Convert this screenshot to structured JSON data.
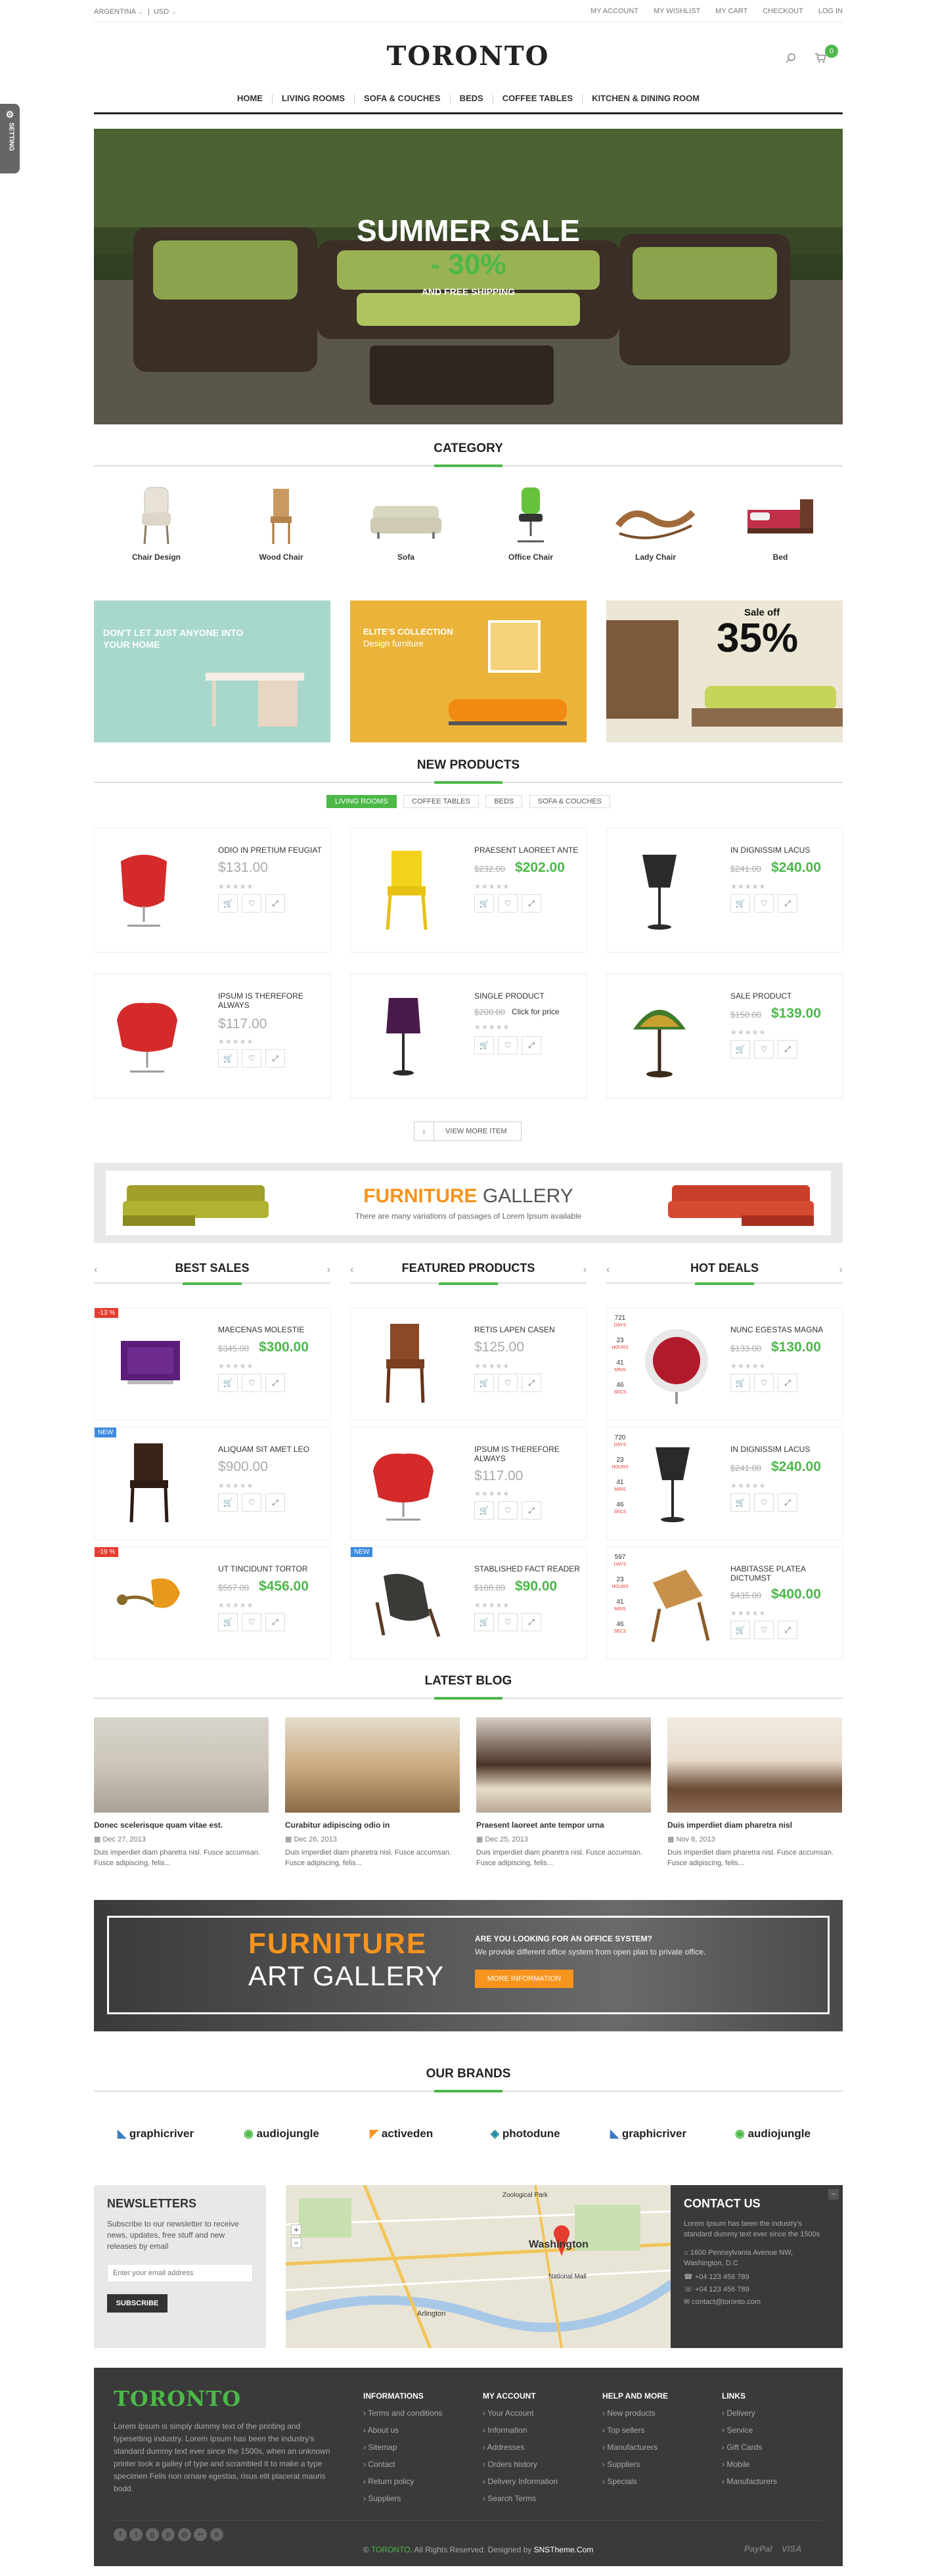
{
  "topbar": {
    "country": "ARGENTINA",
    "currency": "USD",
    "links": [
      "MY ACCOUNT",
      "MY WISHLIST",
      "MY CART",
      "CHECKOUT",
      "LOG IN"
    ]
  },
  "logo": "TORONTO",
  "cart_count": "0",
  "setting_label": "SETTING",
  "nav": [
    "HOME",
    "LIVING ROOMS",
    "SOFA & COUCHES",
    "BEDS",
    "COFFEE TABLES",
    "KITCHEN & DINING ROOM"
  ],
  "hero": {
    "title": "SUMMER SALE",
    "discount": "- 30%",
    "sub": "AND FREE SHIPPING"
  },
  "category": {
    "title": "CATEGORY",
    "items": [
      "Chair Design",
      "Wood Chair",
      "Sofa",
      "Office Chair",
      "Lady Chair",
      "Bed"
    ]
  },
  "banners": {
    "b1": "DON'T LET JUST ANYONE INTO YOUR HOME",
    "b2a": "ELITE'S COLLECTION",
    "b2b": "Design furniture",
    "b3a": "Sale off",
    "b3b": "35%"
  },
  "new_products": {
    "title": "NEW PRODUCTS",
    "tabs": [
      "LIVING ROOMS",
      "COFFEE TABLES",
      "BEDS",
      "SOFA & COUCHES"
    ],
    "items": [
      {
        "name": "ODIO IN PRETIUM FEUGIAT",
        "old": "",
        "price": "$131.00"
      },
      {
        "name": "PRAESENT LAOREET ANTE",
        "old": "$232.00",
        "price": "$202.00"
      },
      {
        "name": "IN DIGNISSIM LACUS",
        "old": "$241.00",
        "price": "$240.00"
      },
      {
        "name": "IPSUM IS THEREFORE ALWAYS",
        "old": "",
        "price": "$117.00"
      },
      {
        "name": "SINGLE PRODUCT",
        "old": "$200.00",
        "price": "Click for price"
      },
      {
        "name": "SALE PRODUCT",
        "old": "$150.00",
        "price": "$139.00"
      }
    ],
    "more": "VIEW MORE ITEM"
  },
  "gallery": {
    "title1": "FURNITURE",
    "title2": "GALLERY",
    "sub": "There are many variations of passages of Lorem Ipsum available"
  },
  "cols": {
    "best": "BEST SALES",
    "featured": "FEATURED PRODUCTS",
    "hot": "HOT DEALS"
  },
  "best": [
    {
      "name": "MAECENAS MOLESTIE",
      "old": "$345.00",
      "price": "$300.00",
      "badge": "-13 %"
    },
    {
      "name": "ALIQUAM SIT AMET LEO",
      "old": "",
      "price": "$900.00",
      "badge": "NEW"
    },
    {
      "name": "UT TINCIDUNT TORTOR",
      "old": "$567.00",
      "price": "$456.00",
      "badge": "-19 %"
    }
  ],
  "featured": [
    {
      "name": "RETIS LAPEN CASEN",
      "old": "",
      "price": "$125.00",
      "badge": ""
    },
    {
      "name": "IPSUM IS THEREFORE ALWAYS",
      "old": "",
      "price": "$117.00",
      "badge": ""
    },
    {
      "name": "STABLISHED FACT READER",
      "old": "$108.00",
      "price": "$90.00",
      "badge": "NEW"
    }
  ],
  "hot": [
    {
      "name": "NUNC EGESTAS MAGNA",
      "old": "$133.00",
      "price": "$130.00",
      "cd": [
        "721",
        "23",
        "41",
        "46"
      ]
    },
    {
      "name": "IN DIGNISSIM LACUS",
      "old": "$241.00",
      "price": "$240.00",
      "cd": [
        "720",
        "23",
        "41",
        "46"
      ]
    },
    {
      "name": "HABITASSE PLATEA DICTUMST",
      "old": "$435.00",
      "price": "$400.00",
      "cd": [
        "597",
        "23",
        "41",
        "46"
      ]
    }
  ],
  "cd_labels": [
    "DAYS",
    "HOURS",
    "MINS",
    "SECS"
  ],
  "blog": {
    "title": "LATEST BLOG",
    "posts": [
      {
        "title": "Donec scelerisque quam vitae est.",
        "date": "Dec 27, 2013",
        "text": "Duis imperdiet diam pharetra nisl. Fusce accumsan. Fusce adipiscing, felis..."
      },
      {
        "title": "Curabitur adipiscing odio in",
        "date": "Dec 26, 2013",
        "text": "Duis imperdiet diam pharetra nisl. Fusce accumsan. Fusce adipiscing, felis..."
      },
      {
        "title": "Praesent laoreet ante tempor urna",
        "date": "Dec 25, 2013",
        "text": "Duis imperdiet diam pharetra nisl. Fusce accumsan. Fusce adipiscing, felis..."
      },
      {
        "title": "Duis imperdiet diam pharetra nisl",
        "date": "Nov 8, 2013",
        "text": "Duis imperdiet diam pharetra nisl. Fusce accumsan. Fusce adipiscing, felis..."
      }
    ]
  },
  "art": {
    "t1": "FURNITURE",
    "t2": "ART GALLERY",
    "q": "ARE YOU LOOKING FOR AN OFFICE SYSTEM?",
    "d": "We provide different office system from open plan to private office.",
    "btn": "MORE INFORMATION"
  },
  "brands": {
    "title": "OUR BRANDS",
    "items": [
      "graphicriver",
      "audiojungle",
      "activeden",
      "photodune",
      "graphicriver",
      "audiojungle"
    ]
  },
  "newsletter": {
    "title": "NEWSLETTERS",
    "text": "Subscribe to our newsletter to receive news, updates, free stuff and new releases by email",
    "placeholder": "Enter your email address",
    "btn": "SUBSCRIBE"
  },
  "map": {
    "city": "Washington",
    "labels": [
      "Arlington",
      "Zoological Park",
      "National Mall"
    ]
  },
  "contact": {
    "title": "CONTACT US",
    "text": "Lorem Ipsum has been the industry's standard dummy text ever since the 1500s",
    "addr": "1600 Pennsylvania Avenue NW, Washington, D.C",
    "p1": "+04 123 456 789",
    "p2": "+04 123 456 789",
    "email": "contact@toronto.com"
  },
  "footer": {
    "logo": "TORONTO",
    "about": "Lorem Ipsum is simply dummy text of the printing and typesetting industry. Lorem Ipsum has been the industry's standard dummy text ever since the 1500s, when an unknown printer took a galley of type and scrambled it to make a type specimen Felis non ornare egestas, risus elit placerat mauris bodd.",
    "cols": [
      {
        "h": "INFORMATIONS",
        "items": [
          "Terms and conditions",
          "About us",
          "Sitemap",
          "Contact",
          "Return policy",
          "Suppliers"
        ]
      },
      {
        "h": "MY ACCOUNT",
        "items": [
          "Your Account",
          "Information",
          "Addresses",
          "Orders history",
          "Delivery Information",
          "Search Terms"
        ]
      },
      {
        "h": "HELP AND MORE",
        "items": [
          "New products",
          "Top sellers",
          "Manufacturers",
          "Suppliers",
          "Specials"
        ]
      },
      {
        "h": "LINKS",
        "items": [
          "Delivery",
          "Service",
          "Gift Cards",
          "Mobile",
          "Manufacturers"
        ]
      }
    ],
    "copy1": "© ",
    "copy2": "TORONTO",
    "copy3": ". All Rights Reserved. Designed by ",
    "copy4": "SNSTheme.Com",
    "pay1": "PayPal",
    "pay2": "VISA"
  },
  "colors": {
    "accent": "#4cb848",
    "orange": "#f7941d",
    "red": "#e53c2f",
    "dark": "#3a3a3a"
  }
}
